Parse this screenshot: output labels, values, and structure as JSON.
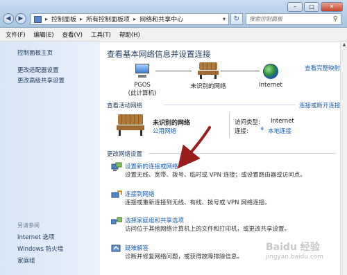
{
  "window": {
    "minimize": "–",
    "maximize": "□",
    "close": "✕"
  },
  "address": {
    "segments": [
      "控制面板",
      "所有控制面板项",
      "网络和共享中心"
    ],
    "separator": "▸",
    "dropdown": "▾"
  },
  "search": {
    "placeholder": "搜索控制面板"
  },
  "menu": [
    "文件(F)",
    "编辑(E)",
    "查看(V)",
    "工具(T)",
    "帮助(H)"
  ],
  "left_pane": {
    "home": "控制面板主页",
    "links": [
      "更改适配器设置",
      "更改高级共享设置"
    ],
    "see_also_title": "另请参阅",
    "see_also": [
      "Internet 选项",
      "Windows 防火墙",
      "家庭组"
    ]
  },
  "main": {
    "title": "查看基本网络信息并设置连接",
    "full_map": "查看完整映射",
    "map_nodes": [
      {
        "name": "PGOS",
        "sub": "(此计算机)"
      },
      {
        "name": "未识别的网络",
        "sub": ""
      },
      {
        "name": "Internet",
        "sub": ""
      }
    ],
    "active_title": "查看活动网络",
    "connect_disconnect": "连接或断开连接",
    "network": {
      "name": "未识别的网络",
      "type": "公用网络",
      "access_label": "访问类型:",
      "access_value": "Internet",
      "conn_label": "连接:",
      "conn_value": "本地连接"
    },
    "change_title": "更改网络设置",
    "tasks": [
      {
        "link": "设置新的连接或网络",
        "desc": "设置无线、宽带、拨号、临时或 VPN 连接；或设置路由器或访问点。"
      },
      {
        "link": "连接到网络",
        "desc": "连接或重新连接到无线、有线、拨号或 VPN 网络连接。"
      },
      {
        "link": "选择家庭组和共享选项",
        "desc": "访问位于其他网络计算机上的文件和打印机，或更改共享设置。"
      },
      {
        "link": "疑难解答",
        "desc": "诊断并修复网络问题，或获得故障排除信息。"
      }
    ]
  },
  "watermark": {
    "brand": "Baidu 经验",
    "url": "jingyan.baidu.com"
  },
  "colors": {
    "link": "#1a5fb4",
    "heading": "#1e395b",
    "annotation_arrow": "#9b1c1c"
  }
}
